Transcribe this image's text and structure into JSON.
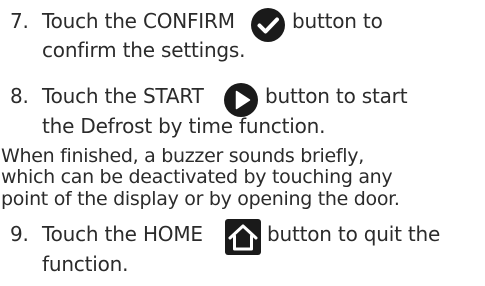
{
  "steps": [
    {
      "number": "7.",
      "line1_before": "Touch the CONFIRM",
      "line1_after": "button to",
      "line2": "confirm the settings.",
      "icon": "confirm-check-icon"
    },
    {
      "number": "8.",
      "line1_before": "Touch the START",
      "line1_after": "button to start",
      "line2": "the Defrost by time function.",
      "icon": "start-play-icon"
    },
    {
      "number": "9.",
      "line1_before": "Touch the HOME",
      "line1_after": "button to quit the",
      "line2": "function.",
      "icon": "home-icon"
    }
  ],
  "note": {
    "line1": "When finished, a buzzer sounds briefly,",
    "line2": "which can be deactivated by touching any",
    "line3": "point of the display or by opening the door."
  },
  "colors": {
    "text": "#2b2b2b",
    "icon_fill": "#1a1a1a",
    "icon_glyph": "#ffffff"
  }
}
